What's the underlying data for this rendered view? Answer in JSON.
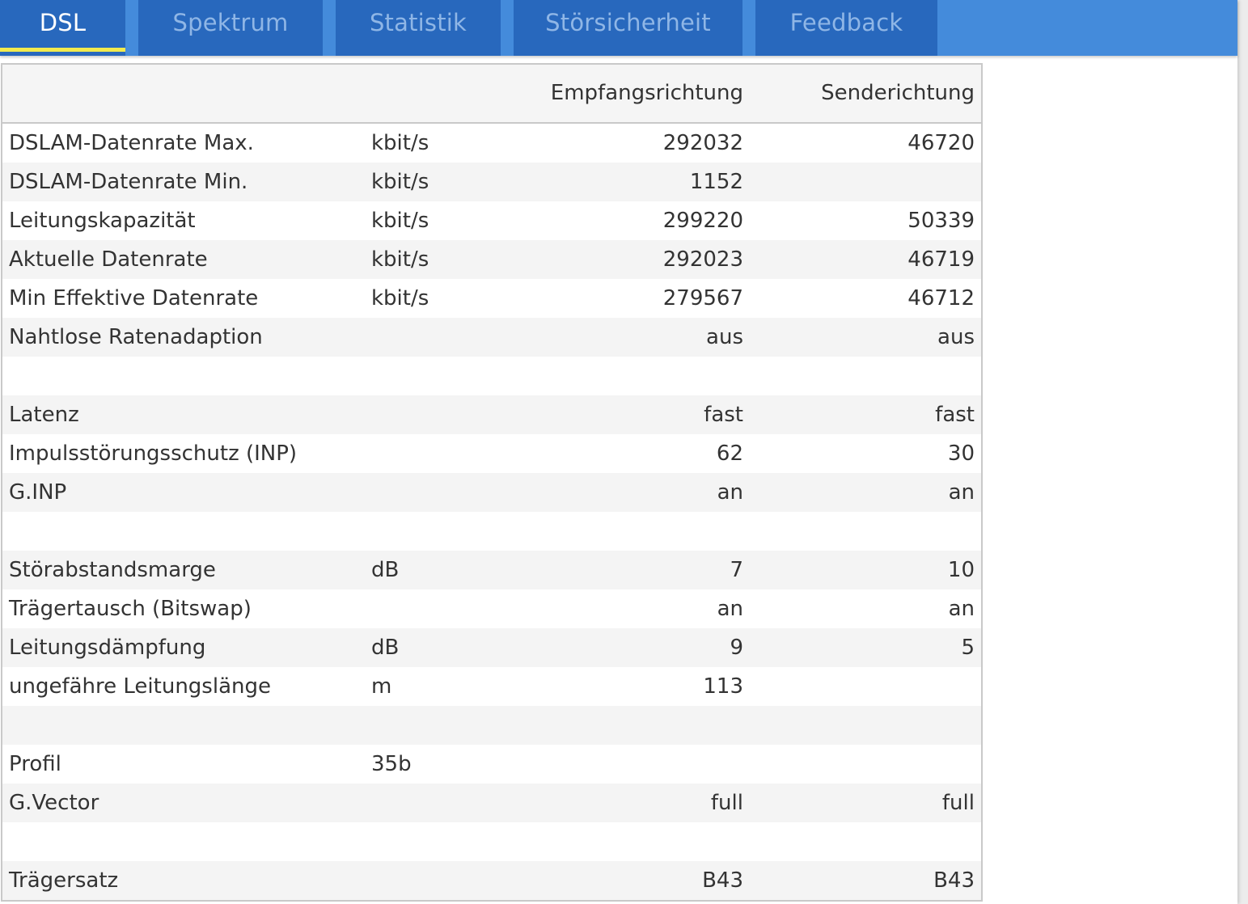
{
  "tabs": [
    {
      "label": "DSL",
      "active": true
    },
    {
      "label": "Spektrum",
      "active": false
    },
    {
      "label": "Statistik",
      "active": false
    },
    {
      "label": "Störsicherheit",
      "active": false
    },
    {
      "label": "Feedback",
      "active": false
    }
  ],
  "colors": {
    "tab_bar": "#448bdb",
    "tab_bg": "#2868bd",
    "tab_active_text": "#ffffff",
    "tab_inactive_text": "#8fb6e6",
    "active_indicator": "#f2ea4e"
  },
  "table": {
    "headers": {
      "label": "",
      "unit": "",
      "down": "Empfangsrichtung",
      "up": "Senderichtung"
    },
    "rows": [
      {
        "label": "DSLAM-Datenrate Max.",
        "unit": "kbit/s",
        "down": "292032",
        "up": "46720"
      },
      {
        "label": "DSLAM-Datenrate Min.",
        "unit": "kbit/s",
        "down": "1152",
        "up": ""
      },
      {
        "label": "Leitungskapazität",
        "unit": "kbit/s",
        "down": "299220",
        "up": "50339"
      },
      {
        "label": "Aktuelle Datenrate",
        "unit": "kbit/s",
        "down": "292023",
        "up": "46719"
      },
      {
        "label": "Min Effektive Datenrate",
        "unit": "kbit/s",
        "down": "279567",
        "up": "46712"
      },
      {
        "label": "Nahtlose Ratenadaption",
        "unit": "",
        "down": "aus",
        "up": "aus"
      },
      {
        "label": "",
        "unit": "",
        "down": "",
        "up": ""
      },
      {
        "label": "Latenz",
        "unit": "",
        "down": "fast",
        "up": "fast"
      },
      {
        "label": "Impulsstörungsschutz (INP)",
        "unit": "",
        "down": "62",
        "up": "30"
      },
      {
        "label": "G.INP",
        "unit": "",
        "down": "an",
        "up": "an"
      },
      {
        "label": "",
        "unit": "",
        "down": "",
        "up": ""
      },
      {
        "label": "Störabstandsmarge",
        "unit": "dB",
        "down": "7",
        "up": "10"
      },
      {
        "label": "Trägertausch (Bitswap)",
        "unit": "",
        "down": "an",
        "up": "an"
      },
      {
        "label": "Leitungsdämpfung",
        "unit": "dB",
        "down": "9",
        "up": "5"
      },
      {
        "label": "ungefähre Leitungslänge",
        "unit": "m",
        "down": "113",
        "up": ""
      },
      {
        "label": "",
        "unit": "",
        "down": "",
        "up": ""
      },
      {
        "label": "Profil",
        "unit": "35b",
        "down": "",
        "up": ""
      },
      {
        "label": "G.Vector",
        "unit": "",
        "down": "full",
        "up": "full"
      },
      {
        "label": "",
        "unit": "",
        "down": "",
        "up": ""
      },
      {
        "label": "Trägersatz",
        "unit": "",
        "down": "B43",
        "up": "B43"
      }
    ]
  }
}
